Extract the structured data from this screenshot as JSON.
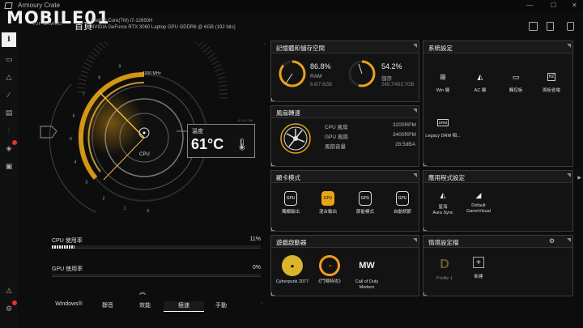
{
  "titlebar": {
    "app_title": "Armoury Crate"
  },
  "watermark": {
    "brand": "MOBILE01",
    "home_label": "首頁",
    "sub_badge": "TUF GAMING"
  },
  "system_info": {
    "cpu": "Intel(R) Core(TM) i7-12650H",
    "gpu": "NVIDIA GeForce RTX 3060 Laptop GPU GDDR6 @ 6GB (192 bits)"
  },
  "gauge": {
    "clock_label": "1000 MHz",
    "cpu_label": "CPU",
    "temperature_label": "溫度",
    "temperature_value": "61°C",
    "version_tag": "6.3.0 / 2M",
    "scale_ticks": [
      "9",
      "8",
      "7",
      "6",
      "5",
      "4",
      "3",
      "2",
      "1",
      "0"
    ]
  },
  "usage": {
    "cpu_label": "CPU 使用率",
    "cpu_value": "11%",
    "cpu_fraction": 0.11,
    "gpu_label": "GPU 使用率",
    "gpu_value": "0%",
    "gpu_fraction": 0.0
  },
  "modes": {
    "tabs": [
      "Windows®",
      "靜音",
      "效能",
      "極速",
      "手動"
    ],
    "active_index": 3
  },
  "cards": {
    "memory": {
      "title": "記憶體和儲存空間",
      "ram_pct": "86.8%",
      "ram_label": "RAM",
      "ram_detail": "6.6/7.6GB",
      "ram_fraction": 0.868,
      "disk_pct": "54.2%",
      "disk_label": "儲存",
      "disk_detail": "245.7/453.7GB",
      "disk_fraction": 0.542
    },
    "fan": {
      "title": "風扇轉速",
      "rows": [
        {
          "label": "CPU 風扇",
          "value": "3200RPM"
        },
        {
          "label": "GPU 風扇",
          "value": "3400RPM"
        },
        {
          "label": "風扇音量",
          "value": "28.5dBA"
        }
      ]
    },
    "system": {
      "title": "系統設定",
      "tiles": [
        {
          "label": "Win 鍵",
          "icon": "windows-key-icon"
        },
        {
          "label": "AC 鍵",
          "icon": "ac-key-icon"
        },
        {
          "label": "觸控板",
          "icon": "touchpad-icon"
        },
        {
          "label": "面板省電",
          "icon": "panel-power-saving-icon",
          "chip": "HZ"
        },
        {
          "label": "Legacy DRM 相...",
          "icon": "legacy-drm-icon",
          "chip": "DRM"
        }
      ]
    },
    "gpu_mode": {
      "title": "顯卡模式",
      "tiles": [
        {
          "label": "獨顯輸出",
          "chip": "GPU"
        },
        {
          "label": "混合輸出",
          "chip": "GPU"
        },
        {
          "label": "節能模式",
          "chip": "GPU"
        },
        {
          "label": "自動調節",
          "chip": "GPU"
        }
      ],
      "active_index": 1
    },
    "apps": {
      "title": "應用程式設定",
      "tiles": [
        {
          "label": "Aura Sync",
          "sub": "星海"
        },
        {
          "label": "GameVisual",
          "sub": "Default"
        }
      ]
    },
    "launcher": {
      "title": "遊戲啟動器",
      "games": [
        {
          "label": "Cyberpunk 2077"
        },
        {
          "label": "《鬥陣特攻》"
        },
        {
          "label": "Call of Duty Modern"
        }
      ]
    },
    "profile": {
      "title": "情境設定檔",
      "tiles": [
        {
          "label": "Profile 1"
        },
        {
          "label": "新建"
        }
      ]
    }
  },
  "colors": {
    "accent": "#e8a317",
    "panel": "#131313",
    "border": "#3a3a3a"
  }
}
